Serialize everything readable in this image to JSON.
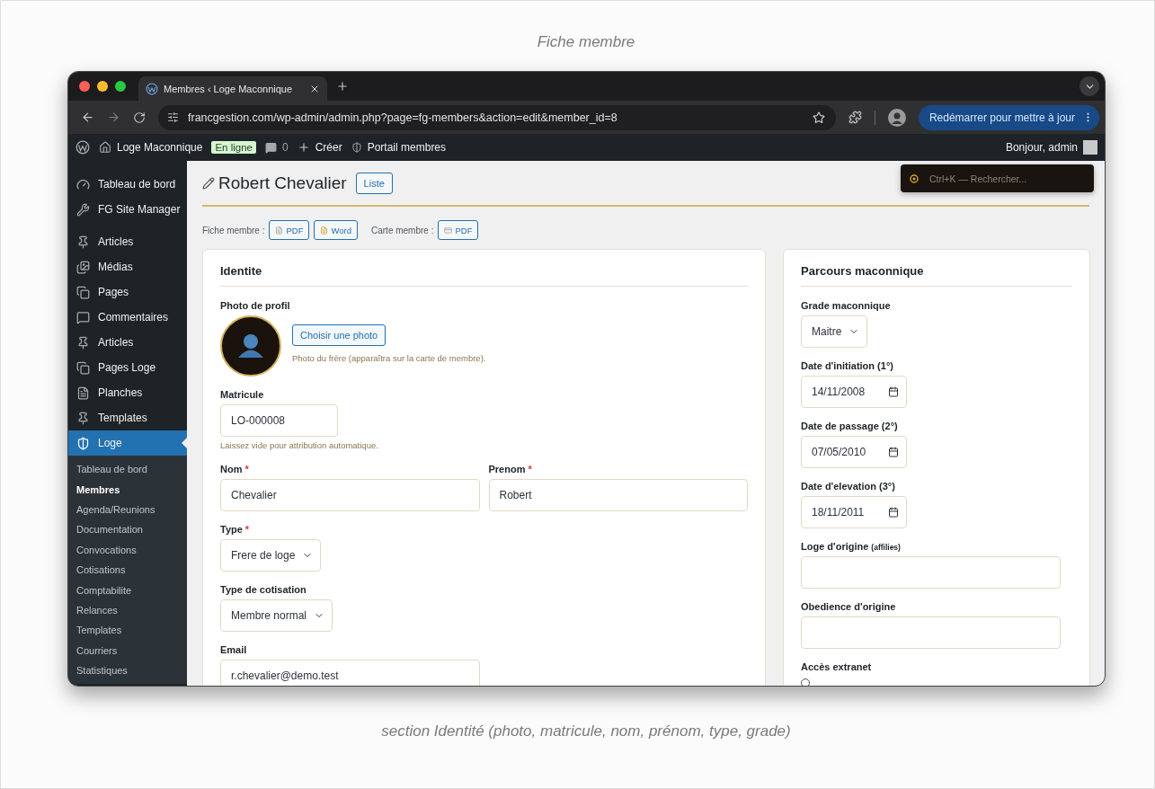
{
  "captions": {
    "top": "Fiche membre",
    "bottom": "section Identité (photo, matricule, nom, prénom, type, grade)"
  },
  "browser": {
    "tab_title": "Membres ‹ Loge Maconnique",
    "url": "francgestion.com/wp-admin/admin.php?page=fg-members&action=edit&member_id=8",
    "update_button": "Redémarrer pour mettre à jour"
  },
  "admin_bar": {
    "site_name": "Loge Maconnique",
    "status_badge": "En ligne",
    "comment_count": "0",
    "new_label": "Créer",
    "portal_label": "Portail membres",
    "greeting": "Bonjour, admin"
  },
  "sidebar": {
    "items": [
      {
        "label": "Tableau de bord",
        "selected": false
      },
      {
        "label": "FG Site Manager",
        "selected": false
      },
      {
        "label": "Articles",
        "selected": false
      },
      {
        "label": "Médias",
        "selected": false
      },
      {
        "label": "Pages",
        "selected": false
      },
      {
        "label": "Commentaires",
        "selected": false
      },
      {
        "label": "Articles",
        "selected": false
      },
      {
        "label": "Pages Loge",
        "selected": false
      },
      {
        "label": "Planches",
        "selected": false
      },
      {
        "label": "Templates",
        "selected": false
      },
      {
        "label": "Loge",
        "selected": true
      }
    ],
    "submenu": [
      {
        "label": "Tableau de bord",
        "selected": false
      },
      {
        "label": "Membres",
        "selected": true
      },
      {
        "label": "Agenda/Reunions",
        "selected": false
      },
      {
        "label": "Documentation",
        "selected": false
      },
      {
        "label": "Convocations",
        "selected": false
      },
      {
        "label": "Cotisations",
        "selected": false
      },
      {
        "label": "Comptabilite",
        "selected": false
      },
      {
        "label": "Relances",
        "selected": false
      },
      {
        "label": "Templates",
        "selected": false
      },
      {
        "label": "Courriers",
        "selected": false
      },
      {
        "label": "Statistiques",
        "selected": false
      }
    ]
  },
  "page": {
    "title": "Robert Chevalier",
    "list_button": "Liste",
    "search_placeholder": "Ctrl+K — Rechercher...",
    "exports": [
      {
        "label": "Fiche membre :",
        "buttons": [
          "PDF",
          "Word"
        ]
      },
      {
        "label": "Carte membre :",
        "buttons": [
          "PDF"
        ]
      }
    ]
  },
  "identity": {
    "title": "Identite",
    "photo": {
      "label": "Photo de profil",
      "button": "Choisir une photo",
      "hint": "Photo du frère (apparaîtra sur la carte de membre)."
    },
    "matricule": {
      "label": "Matricule",
      "value": "LO-000008",
      "hint": "Laissez vide pour attribution automatique."
    },
    "nom": {
      "label": "Nom",
      "required_mark": "*",
      "value": "Chevalier"
    },
    "prenom": {
      "label": "Prenom",
      "required_mark": "*",
      "value": "Robert"
    },
    "type": {
      "label": "Type",
      "required_mark": "*",
      "value": "Frere de loge"
    },
    "cotisation": {
      "label": "Type de cotisation",
      "value": "Membre normal"
    },
    "email": {
      "label": "Email",
      "value": "r.chevalier@demo.test"
    }
  },
  "parcours": {
    "title": "Parcours maconnique",
    "grade": {
      "label": "Grade maconnique",
      "value": "Maitre"
    },
    "initiation": {
      "label": "Date d'initiation (1°)",
      "value": "14/11/2008"
    },
    "passage": {
      "label": "Date de passage (2°)",
      "value": "07/05/2010"
    },
    "elevation": {
      "label": "Date d'elevation (3°)",
      "value": "18/11/2011"
    },
    "loge_origine": {
      "label": "Loge d'origine",
      "note": "(affilies)"
    },
    "obedience": {
      "label": "Obedience d'origine"
    },
    "extranet": {
      "label": "Accès extranet",
      "checked": false
    }
  }
}
